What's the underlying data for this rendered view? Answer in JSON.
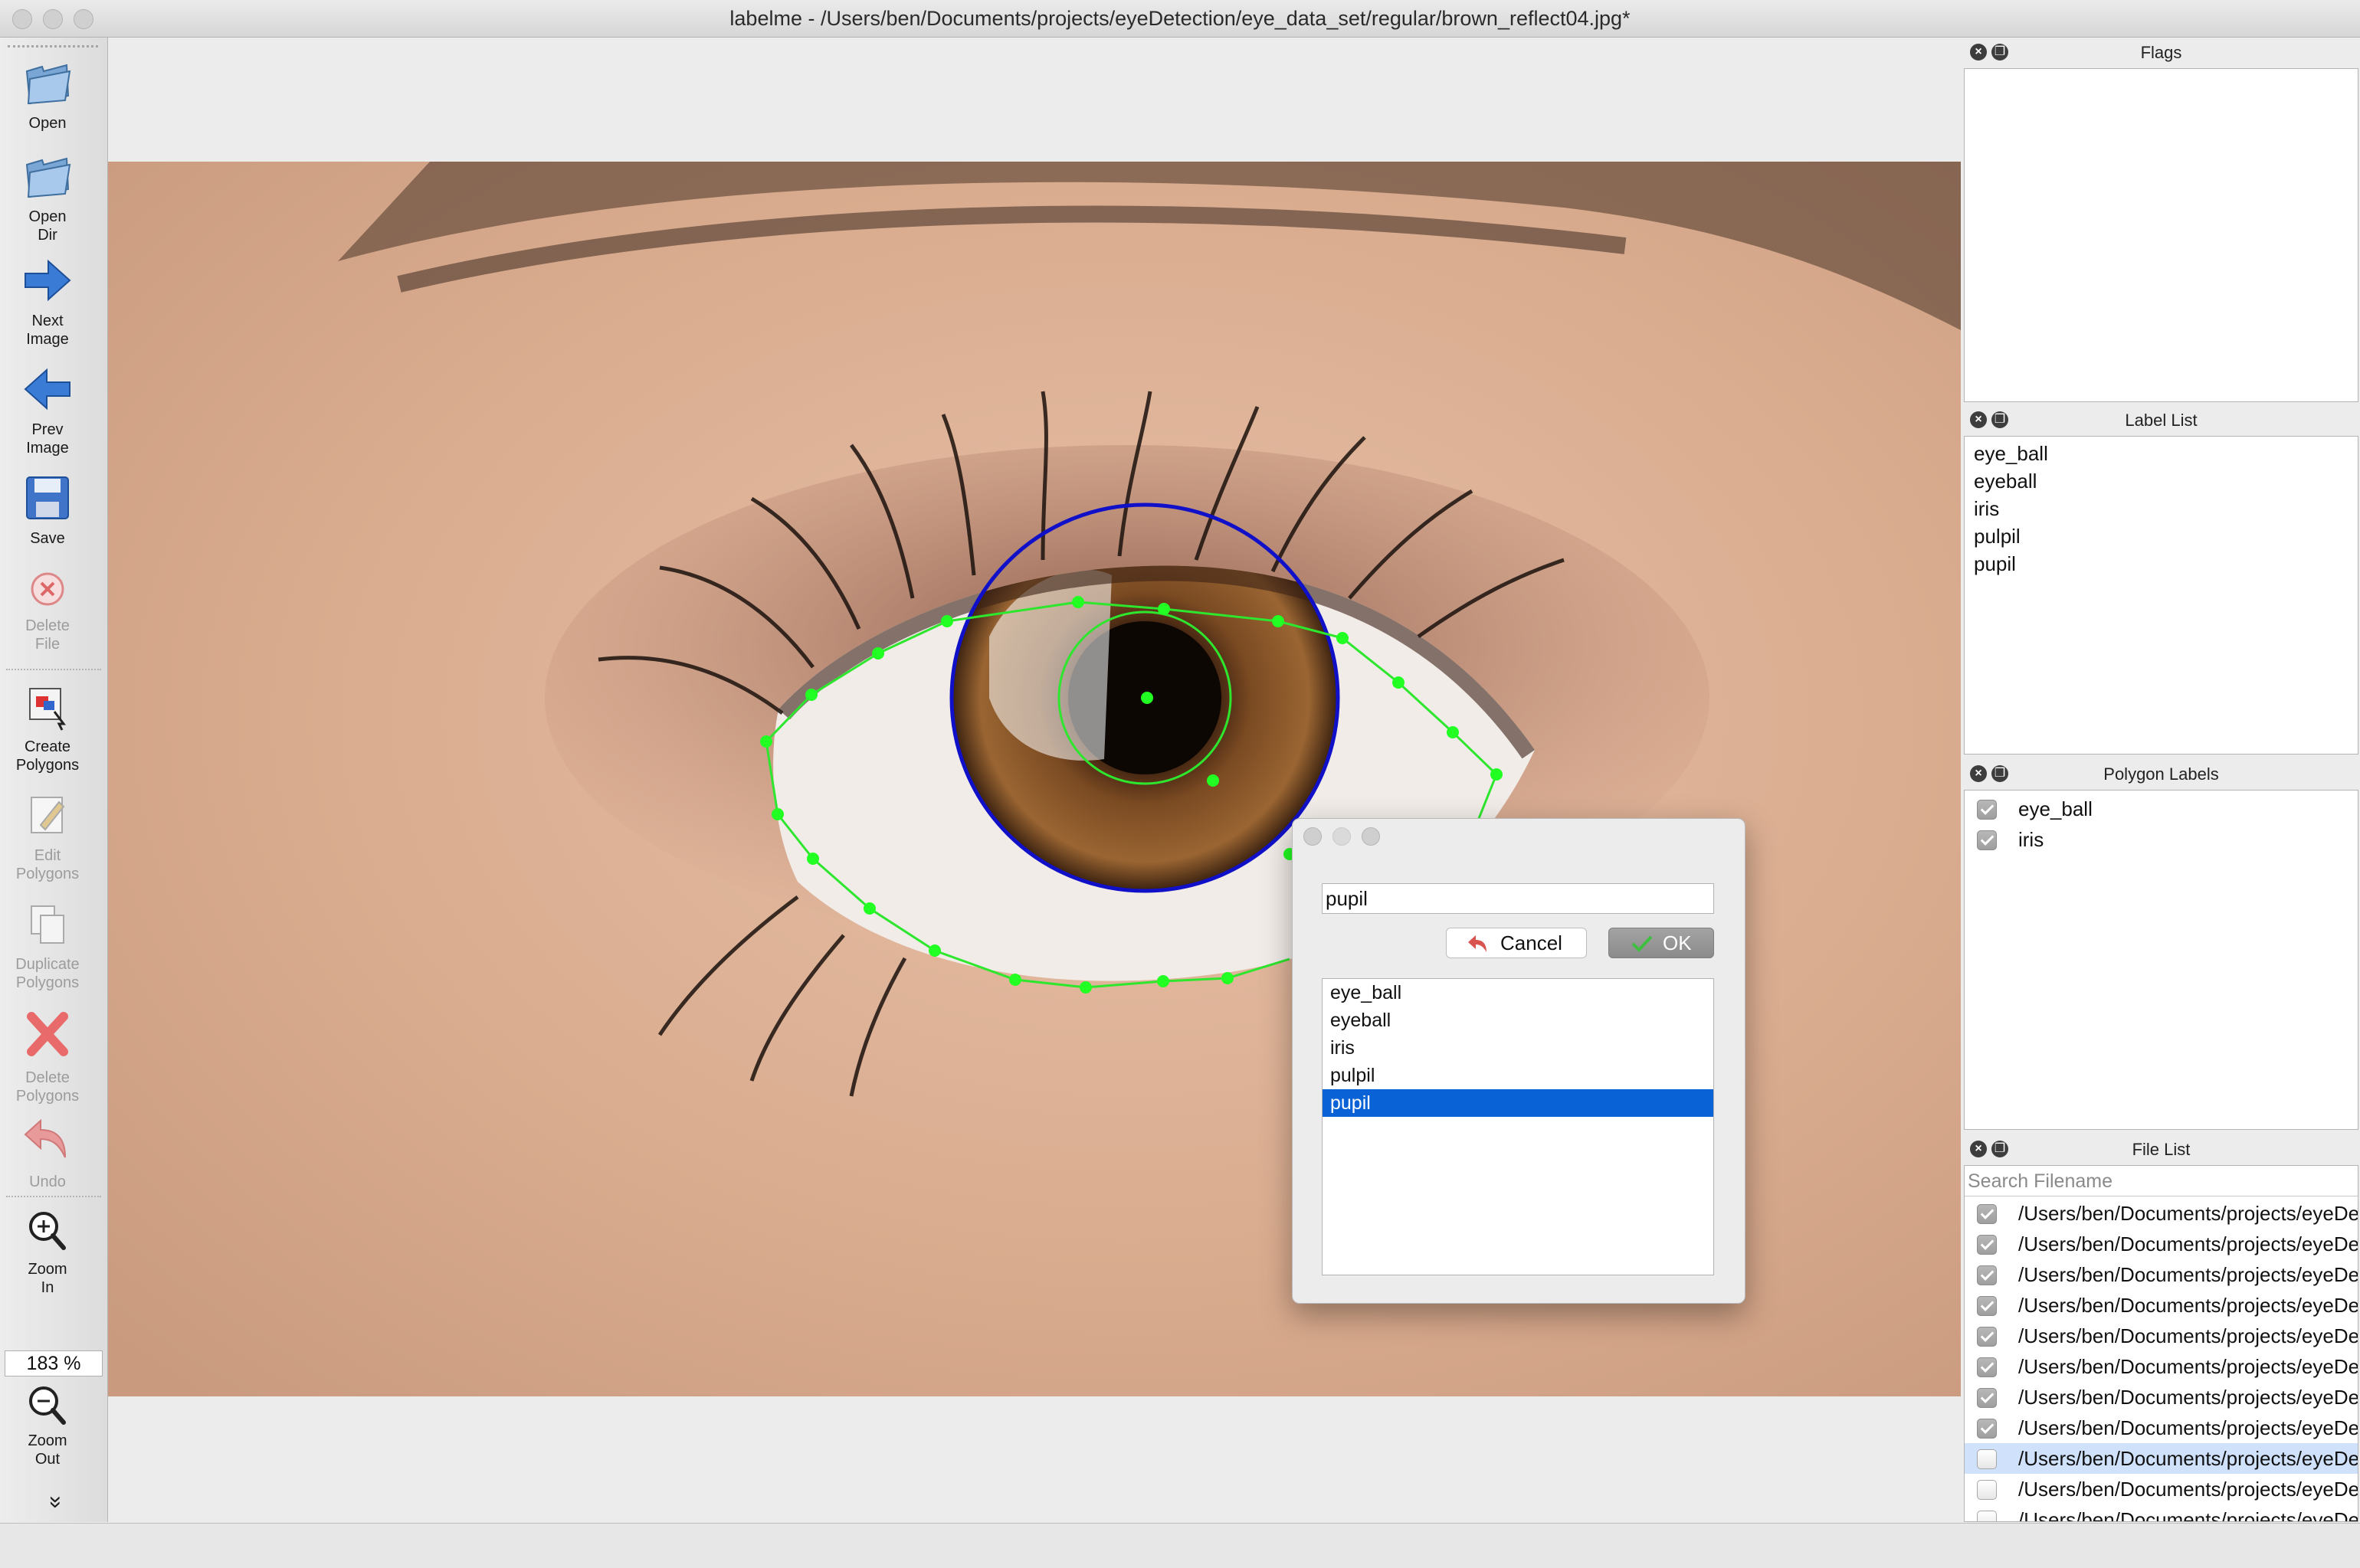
{
  "window": {
    "title": "labelme - /Users/ben/Documents/projects/eyeDetection/eye_data_set/regular/brown_reflect04.jpg*"
  },
  "toolbar": {
    "open": "Open",
    "open_dir": [
      "Open",
      "Dir"
    ],
    "next_image": [
      "Next",
      "Image"
    ],
    "prev_image": [
      "Prev",
      "Image"
    ],
    "save": "Save",
    "delete_file": [
      "Delete",
      "File"
    ],
    "create_polygons": [
      "Create",
      "Polygons"
    ],
    "edit_polygons": [
      "Edit",
      "Polygons"
    ],
    "duplicate_polygons": [
      "Duplicate",
      "Polygons"
    ],
    "delete_polygons": [
      "Delete",
      "Polygons"
    ],
    "undo": "Undo",
    "zoom_in": [
      "Zoom",
      "In"
    ],
    "zoom_value": "183 %",
    "zoom_out": [
      "Zoom",
      "Out"
    ],
    "more": "»"
  },
  "dialog": {
    "input_value": "pupil",
    "cancel_label": "Cancel",
    "ok_label": "OK",
    "labels": [
      "eye_ball",
      "eyeball",
      "iris",
      "pulpil",
      "pupil"
    ],
    "selected_index": 4
  },
  "docks": {
    "flags": {
      "title": "Flags"
    },
    "label_list": {
      "title": "Label List",
      "items": [
        "eye_ball",
        "eyeball",
        "iris",
        "pulpil",
        "pupil"
      ]
    },
    "polygon_labels": {
      "title": "Polygon Labels",
      "items": [
        {
          "label": "eye_ball",
          "checked": true
        },
        {
          "label": "iris",
          "checked": true
        }
      ]
    },
    "file_list": {
      "title": "File List",
      "search_placeholder": "Search Filename",
      "items": [
        {
          "path": "/Users/ben/Documents/projects/eyeDetection",
          "checked": true
        },
        {
          "path": "/Users/ben/Documents/projects/eyeDetection",
          "checked": true
        },
        {
          "path": "/Users/ben/Documents/projects/eyeDetection",
          "checked": true
        },
        {
          "path": "/Users/ben/Documents/projects/eyeDetection",
          "checked": true
        },
        {
          "path": "/Users/ben/Documents/projects/eyeDetection",
          "checked": true
        },
        {
          "path": "/Users/ben/Documents/projects/eyeDetection",
          "checked": true
        },
        {
          "path": "/Users/ben/Documents/projects/eyeDetection",
          "checked": true
        },
        {
          "path": "/Users/ben/Documents/projects/eyeDetection",
          "checked": true
        },
        {
          "path": "/Users/ben/Documents/projects/eyeDetection",
          "checked": false,
          "selected": true
        },
        {
          "path": "/Users/ben/Documents/projects/eyeDetection",
          "checked": false
        },
        {
          "path": "/Users/ben/Documents/projects/eyeDetection",
          "checked": false
        }
      ]
    }
  },
  "colors": {
    "polygon_line": "#2ee62e",
    "polygon_vertex": "#22ff22",
    "circle_outline": "#1010c8",
    "selection": "#0a63d6"
  }
}
